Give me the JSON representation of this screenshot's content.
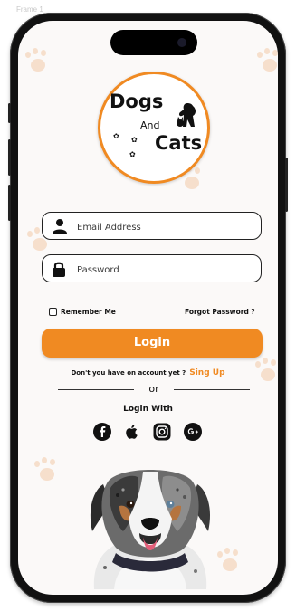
{
  "frame_label": "Frame 1",
  "logo": {
    "line1": "Dogs",
    "line2": "And",
    "line3": "Cats"
  },
  "email": {
    "placeholder": "Email Address",
    "icon": "person-icon"
  },
  "password": {
    "placeholder": "Password",
    "icon": "lock-icon"
  },
  "remember_label": "Remember Me",
  "forgot_label": "Forgot Password ?",
  "login_label": "Login",
  "no_account_text": "Don't you have on account yet ?",
  "signup_label": "Sing Up",
  "or_label": "or",
  "login_with_label": "Login With",
  "social": [
    "facebook-icon",
    "apple-icon",
    "instagram-icon",
    "google-plus-icon"
  ],
  "colors": {
    "accent": "#f08a22",
    "paw": "#f6dfcc",
    "background": "#fbf9f8"
  }
}
